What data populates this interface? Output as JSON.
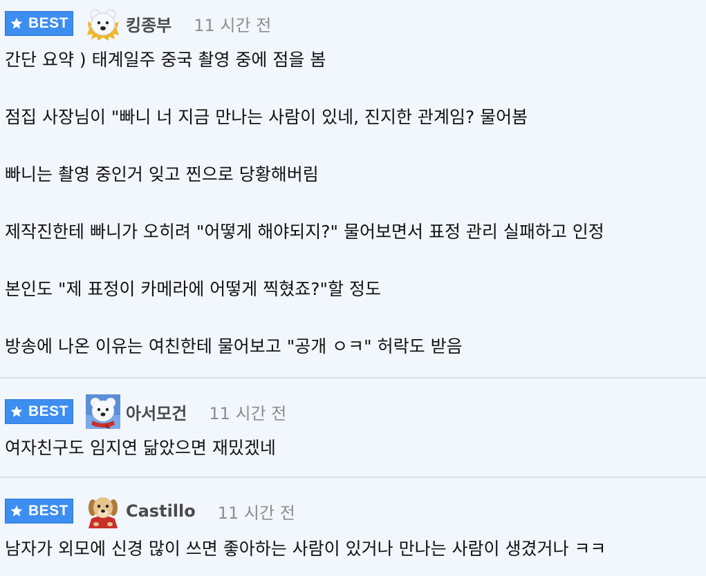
{
  "badge_label": "BEST",
  "colors": {
    "badge_bg": "#3d8ef0",
    "page_bg": "#f2f6fd",
    "divider": "#dde2ea",
    "time_text": "#8d8d8d"
  },
  "comments": [
    {
      "username": "킹종부",
      "avatar_icon": "polar-bear-gold-frame-icon",
      "time": "11 시간 전",
      "lines": [
        "간단 요약 ) 태계일주 중국 촬영 중에 점을 봄",
        "점집 사장님이 \"빠니 너 지금 만나는 사람이 있네, 진지한 관계임? 물어봄",
        "빠니는 촬영 중인거 잊고 찐으로 당황해버림",
        "제작진한테 빠니가 오히려 \"어떻게 해야되지?\" 물어보면서 표정 관리 실패하고 인정",
        "본인도 \"제 표정이 카메라에 어떻게 찍혔죠?\"할 정도",
        "방송에 나온 이유는 여친한테 물어보고 \"공개 ㅇㅋ\" 허락도 받음"
      ]
    },
    {
      "username": "아서모건",
      "avatar_icon": "polar-bear-red-scarf-icon",
      "time": "11 시간 전",
      "lines": [
        "여자친구도 임지연 닮았으면 재밌겠네"
      ]
    },
    {
      "username": "Castillo",
      "avatar_icon": "puppy-red-cape-icon",
      "time": "11 시간 전",
      "lines": [
        "남자가 외모에 신경 많이 쓰면 좋아하는 사람이 있거나 만나는 사람이 생겼거나 ㅋㅋ"
      ]
    }
  ]
}
